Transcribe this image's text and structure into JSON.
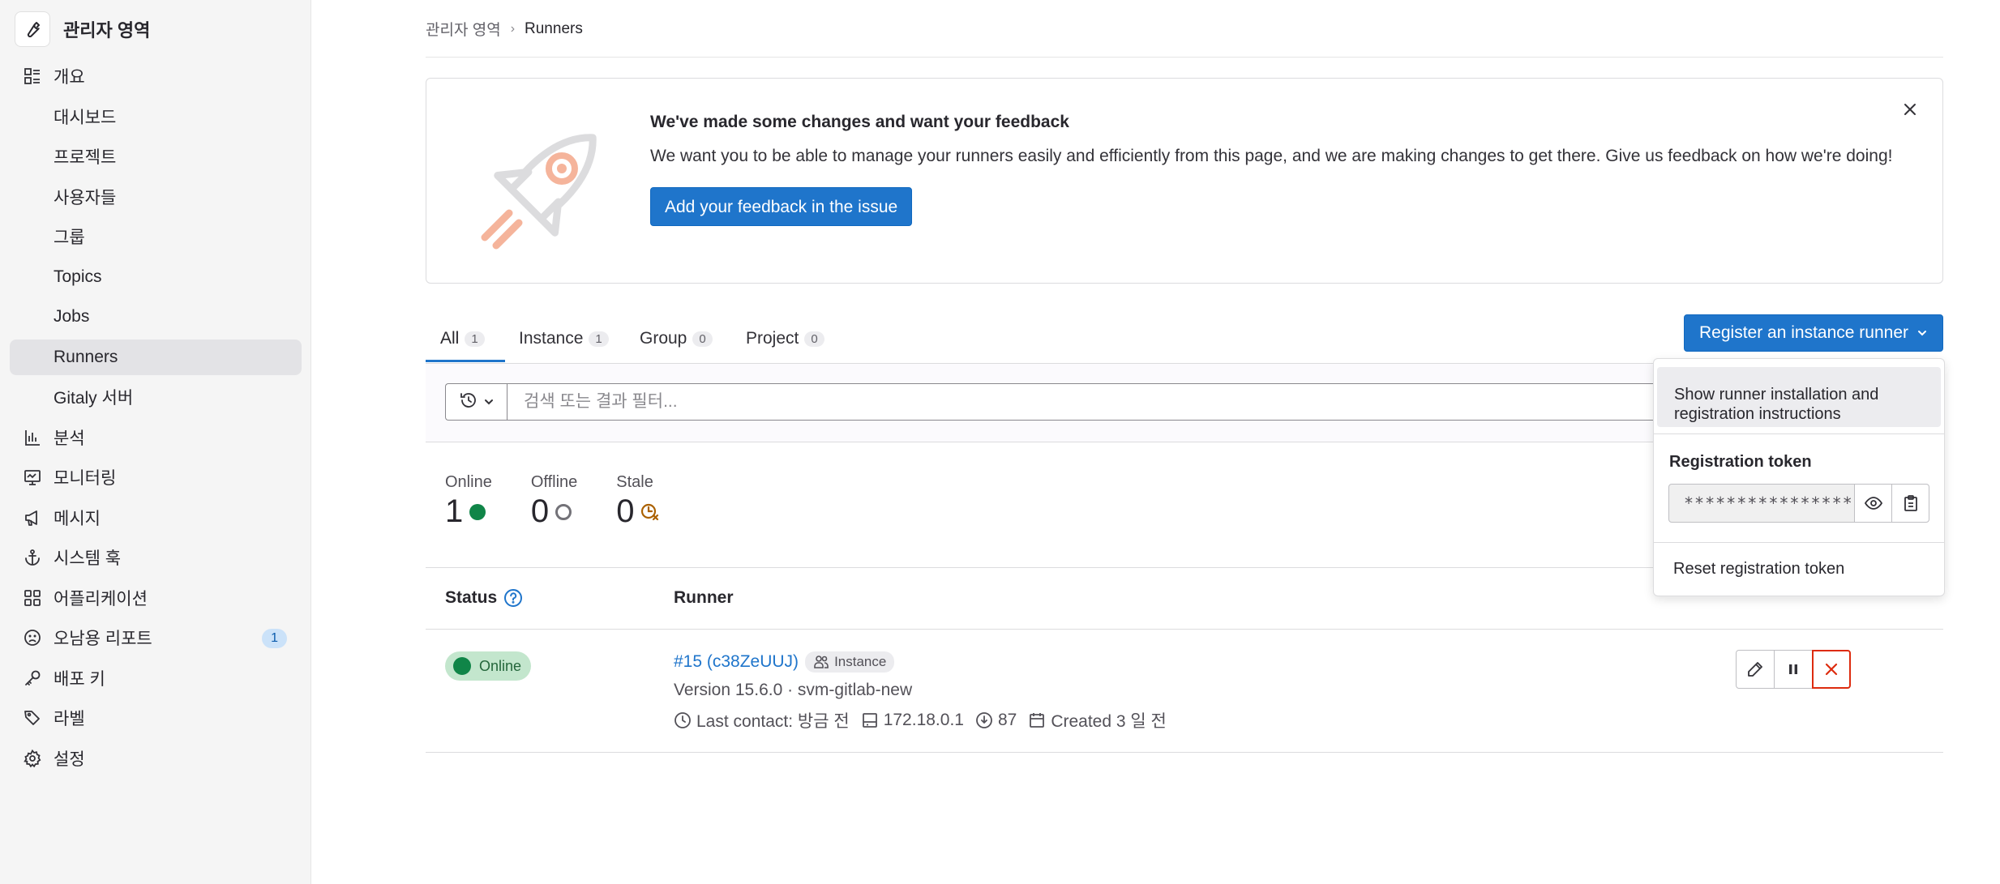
{
  "sidebar": {
    "title": "관리자 영역",
    "items": [
      {
        "label": "개요",
        "icon": "overview-icon"
      },
      {
        "label": "대시보드"
      },
      {
        "label": "프로젝트"
      },
      {
        "label": "사용자들"
      },
      {
        "label": "그룹"
      },
      {
        "label": "Topics"
      },
      {
        "label": "Jobs"
      },
      {
        "label": "Runners"
      },
      {
        "label": "Gitaly 서버"
      },
      {
        "label": "분석",
        "icon": "chart-icon"
      },
      {
        "label": "모니터링",
        "icon": "monitor-icon"
      },
      {
        "label": "메시지",
        "icon": "bullhorn-icon"
      },
      {
        "label": "시스템 훅",
        "icon": "anchor-icon"
      },
      {
        "label": "어플리케이션",
        "icon": "applications-icon"
      },
      {
        "label": "오남용 리포트",
        "icon": "slight-frown-icon",
        "count": "1"
      },
      {
        "label": "배포 키",
        "icon": "key-icon"
      },
      {
        "label": "라벨",
        "icon": "labels-icon"
      },
      {
        "label": "설정",
        "icon": "settings-icon"
      }
    ]
  },
  "breadcrumb": {
    "parent": "관리자 영역",
    "current": "Runners"
  },
  "feedback": {
    "title": "We've made some changes and want your feedback",
    "body": "We want you to be able to manage your runners easily and efficiently from this page, and we are making changes to get there. Give us feedback on how we're doing!",
    "button": "Add your feedback in the issue"
  },
  "tabs": [
    {
      "label": "All",
      "count": "1"
    },
    {
      "label": "Instance",
      "count": "1"
    },
    {
      "label": "Group",
      "count": "0"
    },
    {
      "label": "Project",
      "count": "0"
    }
  ],
  "register_button": "Register an instance runner",
  "search": {
    "placeholder": "검색 또는 결과 필터..."
  },
  "stats": [
    {
      "label": "Online",
      "value": "1"
    },
    {
      "label": "Offline",
      "value": "0"
    },
    {
      "label": "Stale",
      "value": "0"
    }
  ],
  "table": {
    "headers": {
      "status": "Status",
      "runner": "Runner"
    },
    "rows": [
      {
        "status": "Online",
        "id": "#15 (c38ZeUUJ)",
        "type": "Instance",
        "version": "Version 15.6.0 · svm-gitlab-new",
        "last_contact": "Last contact: 방금 전",
        "ip": "172.18.0.1",
        "jobs": "87",
        "created": "Created 3 일 전"
      }
    ]
  },
  "dropdown": {
    "show_instructions": "Show runner installation and registration instructions",
    "token_heading": "Registration token",
    "token_value": "****************",
    "reset": "Reset registration token"
  },
  "colors": {
    "primary": "#1f75cb",
    "online": "#108548",
    "danger": "#dd2b0e",
    "stale": "#ab6100"
  }
}
